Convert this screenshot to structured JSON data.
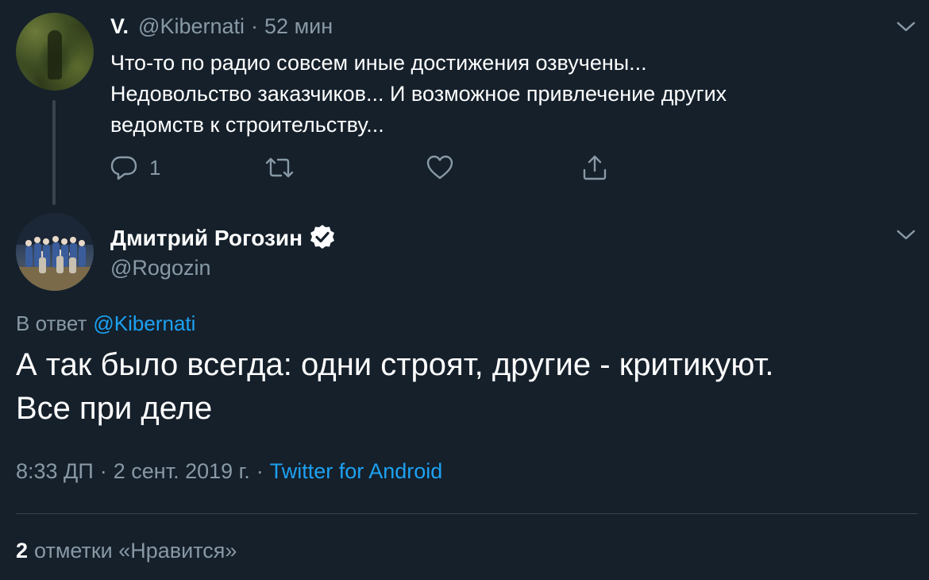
{
  "parent_tweet": {
    "author_name": "V.",
    "author_handle": "@Kibernati",
    "separator": "·",
    "time_ago": "52 мин",
    "text_lines": [
      "Что-то по радио совсем иные достижения озвучены...",
      "Недовольство заказчиков... И возможное привлечение других",
      "ведомств к строительству..."
    ],
    "reply_count": "1",
    "icons": {
      "reply": "reply-icon",
      "retweet": "retweet-icon",
      "like": "heart-icon",
      "share": "share-icon",
      "menu": "chevron-down-icon"
    }
  },
  "main_tweet": {
    "author_name": "Дмитрий Рогозин",
    "verified": true,
    "author_handle": "@Rogozin",
    "reply_label": "В ответ",
    "reply_to_handle": "@Kibernati",
    "text_lines": [
      "А так было всегда: одни строят, другие - критикуют.",
      "Все при деле"
    ],
    "time": "8:33 ДП",
    "separator": "·",
    "date": "2 сент. 2019 г.",
    "source": "Twitter for Android",
    "likes_count": "2",
    "likes_label": "отметки «Нравится»"
  },
  "colors": {
    "background": "#15202b",
    "text_primary": "#ffffff",
    "text_muted": "#8899a6",
    "accent": "#1da1f2",
    "divider": "#38444d"
  }
}
